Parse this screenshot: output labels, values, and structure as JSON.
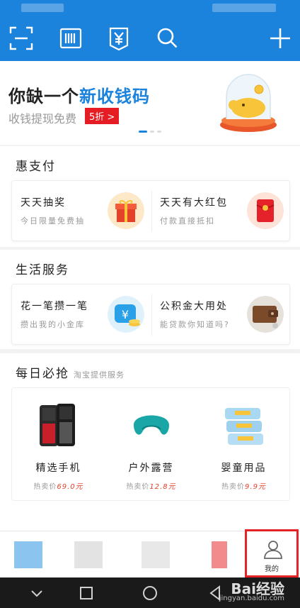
{
  "toolbar": {
    "icons": [
      "scan-icon",
      "barcode-pay-icon",
      "receive-money-icon",
      "search-icon",
      "add-icon"
    ]
  },
  "banner": {
    "title_prefix": "你缺一个",
    "title_highlight": "新收钱码",
    "subtitle": "收钱提现免费",
    "badge": "5折 >",
    "page_index": 1,
    "page_count": 3
  },
  "hui_pay": {
    "heading": "惠支付",
    "cards": [
      {
        "title": "天天抽奖",
        "subtitle": "今日限量免费抽"
      },
      {
        "title": "天天有大红包",
        "subtitle": "付款直接抵扣"
      }
    ]
  },
  "life_services": {
    "heading": "生活服务",
    "cards": [
      {
        "title": "花一笔攒一笔",
        "subtitle": "攒出我的小金库"
      },
      {
        "title": "公积金大用处",
        "subtitle": "能贷款你知道吗?"
      }
    ]
  },
  "daily_deals": {
    "heading": "每日必抢",
    "subheading": "淘宝提供服务",
    "products": [
      {
        "name": "精选手机",
        "price_label": "热卖价",
        "price": "69.0元"
      },
      {
        "name": "户外露营",
        "price_label": "热卖价",
        "price": "12.8元"
      },
      {
        "name": "婴童用品",
        "price_label": "热卖价",
        "price": "9.9元"
      }
    ]
  },
  "tabbar": {
    "mine_label": "我的"
  },
  "watermark": {
    "brand": "Bai经验",
    "url": "jingyan.baidu.com"
  },
  "colors": {
    "brand_blue": "#1b83dc",
    "highlight_red": "#e5212a",
    "price_red": "#e5412a"
  }
}
